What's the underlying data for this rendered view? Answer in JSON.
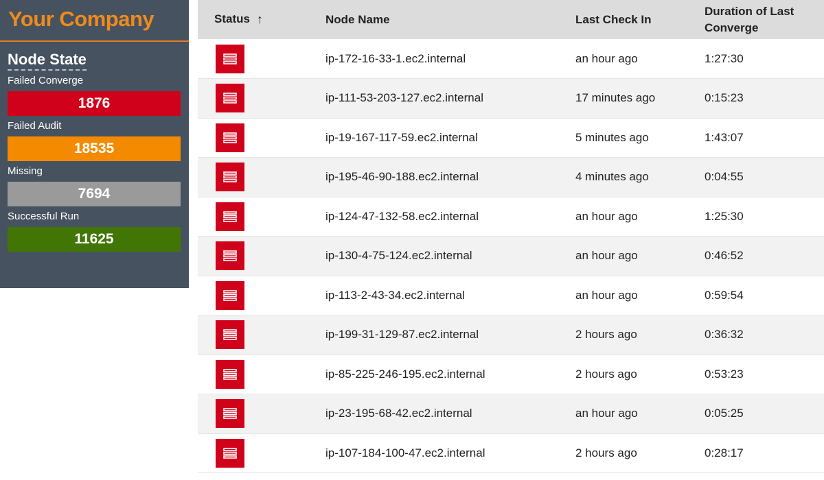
{
  "brand": {
    "name": "Your Company"
  },
  "sidebar": {
    "title": "Node State",
    "states": [
      {
        "label": "Failed Converge",
        "count": "1876"
      },
      {
        "label": "Failed Audit",
        "count": "18535"
      },
      {
        "label": "Missing",
        "count": "7694"
      },
      {
        "label": "Successful Run",
        "count": "11625"
      }
    ]
  },
  "colors": {
    "failed_converge": "#d0021b",
    "failed_audit": "#f38a00",
    "missing": "#9a9a9a",
    "successful_run": "#417505",
    "brand_accent": "#f08a1c",
    "sidebar_bg": "#46525f"
  },
  "table": {
    "headers": {
      "status": "Status",
      "node_name": "Node Name",
      "last_check_in": "Last Check In",
      "duration": "Duration of Last Converge"
    },
    "sort_indicator": "↑",
    "status_icon": "server-icon",
    "rows": [
      {
        "node_name": "ip-172-16-33-1.ec2.internal",
        "last_check_in": "an hour ago",
        "duration": "1:27:30"
      },
      {
        "node_name": "ip-111-53-203-127.ec2.internal",
        "last_check_in": "17 minutes ago",
        "duration": "0:15:23"
      },
      {
        "node_name": "ip-19-167-117-59.ec2.internal",
        "last_check_in": "5 minutes ago",
        "duration": "1:43:07"
      },
      {
        "node_name": "ip-195-46-90-188.ec2.internal",
        "last_check_in": "4 minutes ago",
        "duration": "0:04:55"
      },
      {
        "node_name": "ip-124-47-132-58.ec2.internal",
        "last_check_in": "an hour ago",
        "duration": "1:25:30"
      },
      {
        "node_name": "ip-130-4-75-124.ec2.internal",
        "last_check_in": "an hour ago",
        "duration": "0:46:52"
      },
      {
        "node_name": "ip-113-2-43-34.ec2.internal",
        "last_check_in": "an hour ago",
        "duration": "0:59:54"
      },
      {
        "node_name": "ip-199-31-129-87.ec2.internal",
        "last_check_in": "2 hours ago",
        "duration": "0:36:32"
      },
      {
        "node_name": "ip-85-225-246-195.ec2.internal",
        "last_check_in": "2 hours ago",
        "duration": "0:53:23"
      },
      {
        "node_name": "ip-23-195-68-42.ec2.internal",
        "last_check_in": "an hour ago",
        "duration": "0:05:25"
      },
      {
        "node_name": "ip-107-184-100-47.ec2.internal",
        "last_check_in": "2 hours ago",
        "duration": "0:28:17"
      }
    ]
  }
}
